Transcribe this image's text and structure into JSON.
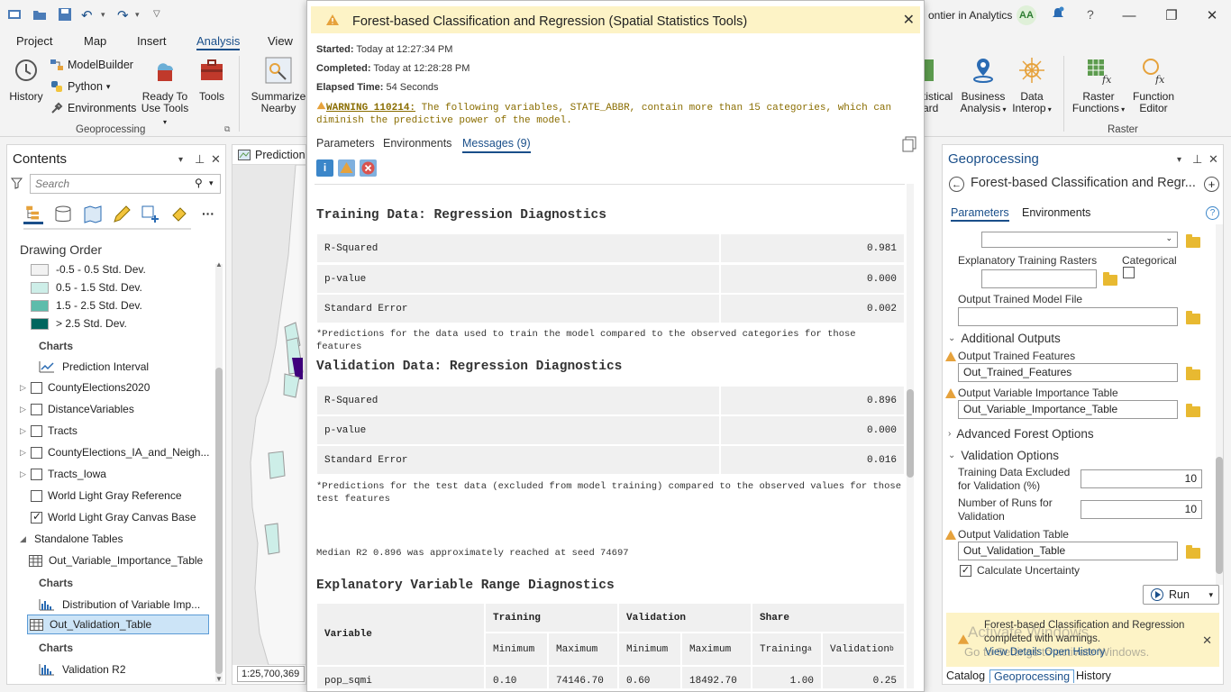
{
  "titlebar": {
    "title_fragment": "ontier in Analytics",
    "avatar_initials": "AA"
  },
  "ribbon": {
    "tabs": [
      "Project",
      "Map",
      "Insert",
      "Analysis",
      "View"
    ],
    "active_tab": "Analysis",
    "history_label": "History",
    "modelbuilder_label": "ModelBuilder",
    "python_label": "Python",
    "environments_label": "Environments",
    "ready_to_use_line1": "Ready To",
    "ready_to_use_line2": "Use Tools",
    "tools_label": "Tools",
    "geoprocessing_group": "Geoprocessing",
    "summarize_line1": "Summarize",
    "summarize_line2": "Nearby",
    "partial_line1": "tistical",
    "partial_line2": "ard",
    "business_line1": "Business",
    "business_line2": "Analysis",
    "interop_line1": "Data",
    "interop_line2": "Interop",
    "raster_fn_line1": "Raster",
    "raster_fn_line2": "Functions",
    "fn_editor_line1": "Function",
    "fn_editor_line2": "Editor",
    "raster_group": "Raster"
  },
  "contents": {
    "title": "Contents",
    "search_placeholder": "Search",
    "drawing_order": "Drawing Order",
    "legend": [
      {
        "label": "-0.5 - 0.5 Std. Dev.",
        "color": "#f2f2f2"
      },
      {
        "label": "0.5 - 1.5 Std. Dev.",
        "color": "#cdeee8"
      },
      {
        "label": "1.5 - 2.5 Std. Dev.",
        "color": "#5dbcab"
      },
      {
        "label": "> 2.5 Std. Dev.",
        "color": "#01665e"
      }
    ],
    "charts_label": "Charts",
    "prediction_interval": "Prediction Interval",
    "layers": [
      {
        "label": "CountyElections2020",
        "checked": false,
        "expand": true
      },
      {
        "label": "DistanceVariables",
        "checked": false,
        "expand": true
      },
      {
        "label": "Tracts",
        "checked": false,
        "expand": true
      },
      {
        "label": "CountyElections_IA_and_Neigh...",
        "checked": false,
        "expand": true
      },
      {
        "label": "Tracts_Iowa",
        "checked": false,
        "expand": true
      },
      {
        "label": "World Light Gray Reference",
        "checked": false,
        "expand": false
      },
      {
        "label": "World Light Gray Canvas Base",
        "checked": true,
        "expand": false
      }
    ],
    "standalone_tables": "Standalone Tables",
    "table1": "Out_Variable_Importance_Table",
    "charts_label2": "Charts",
    "chart1": "Distribution of Variable Imp...",
    "table2": "Out_Validation_Table",
    "charts_label3": "Charts",
    "chart2": "Validation R2"
  },
  "map": {
    "tab_label": "Prediction",
    "scale": "1:25,700,369"
  },
  "dialog": {
    "title": "Forest-based Classification and Regression (Spatial Statistics Tools)",
    "started_label": "Started:",
    "started_value": "Today at 12:27:34 PM",
    "completed_label": "Completed:",
    "completed_value": "Today at 12:28:28 PM",
    "elapsed_label": "Elapsed Time:",
    "elapsed_value": "54 Seconds",
    "warning_code": "WARNING 110214:",
    "warning_text": " The following variables, STATE_ABBR, contain more than 15 categories, which can diminish the predictive power of the model.",
    "tabs": [
      "Parameters",
      "Environments",
      "Messages (9)"
    ],
    "training_title": "Training Data: Regression Diagnostics",
    "training_rows": [
      {
        "k": "R-Squared",
        "v": "0.981"
      },
      {
        "k": "p-value",
        "v": "0.000"
      },
      {
        "k": "Standard Error",
        "v": "0.002"
      }
    ],
    "training_note": "*Predictions for the data used to train the model compared to the observed categories for those features",
    "validation_title": "Validation Data: Regression Diagnostics",
    "validation_rows": [
      {
        "k": "R-Squared",
        "v": "0.896"
      },
      {
        "k": "p-value",
        "v": "0.000"
      },
      {
        "k": "Standard Error",
        "v": "0.016"
      }
    ],
    "validation_note": "*Predictions for the test data (excluded from model training) compared to the observed values for those test features",
    "median_note": "Median R2 0.896 was approximately reached at seed 74697",
    "range_title": "Explanatory Variable Range Diagnostics",
    "range_headers": {
      "variable": "Variable",
      "training": "Training",
      "validation": "Validation",
      "share": "Share",
      "min": "Minimum",
      "max": "Maximum",
      "share_training": "Training",
      "share_training_sup": "a",
      "share_validation": "Validation",
      "share_validation_sup": "b"
    },
    "range_row": {
      "variable": "pop_sqmi",
      "t_min": "0.10",
      "t_max": "74146.70",
      "v_min": "0.60",
      "v_max": "18492.70",
      "s_train": "1.00",
      "s_val": "0.25"
    }
  },
  "geopane": {
    "title": "Geoprocessing",
    "tool_name": "Forest-based Classification and Regr...",
    "tabs": [
      "Parameters",
      "Environments"
    ],
    "explanatory_rasters_label": "Explanatory Training Rasters",
    "categorical_label": "Categorical",
    "output_model_label": "Output Trained Model File",
    "additional_outputs": "Additional Outputs",
    "out_trained_features_label": "Output Trained Features",
    "out_trained_features_value": "Out_Trained_Features",
    "out_var_imp_label": "Output Variable Importance Table",
    "out_var_imp_value": "Out_Variable_Importance_Table",
    "advanced_forest": "Advanced Forest Options",
    "validation_options": "Validation Options",
    "training_excluded_line1": "Training Data Excluded",
    "training_excluded_line2": "for Validation (%)",
    "training_excluded_value": "10",
    "num_runs_line1": "Number of Runs for",
    "num_runs_line2": "Validation",
    "num_runs_value": "10",
    "out_validation_label": "Output  Validation Table",
    "out_validation_value": "Out_Validation_Table",
    "calc_uncertainty": "Calculate Uncertainty",
    "run_label": "Run",
    "notice_text": "Forest-based Classification and Regression completed with warnings.",
    "notice_link": "View Details  Open History",
    "watermark1": "Activate Windows",
    "watermark2": "Go to Settings to activate Windows.",
    "bottom_tabs": [
      "Catalog",
      "Geoprocessing",
      "History"
    ]
  }
}
